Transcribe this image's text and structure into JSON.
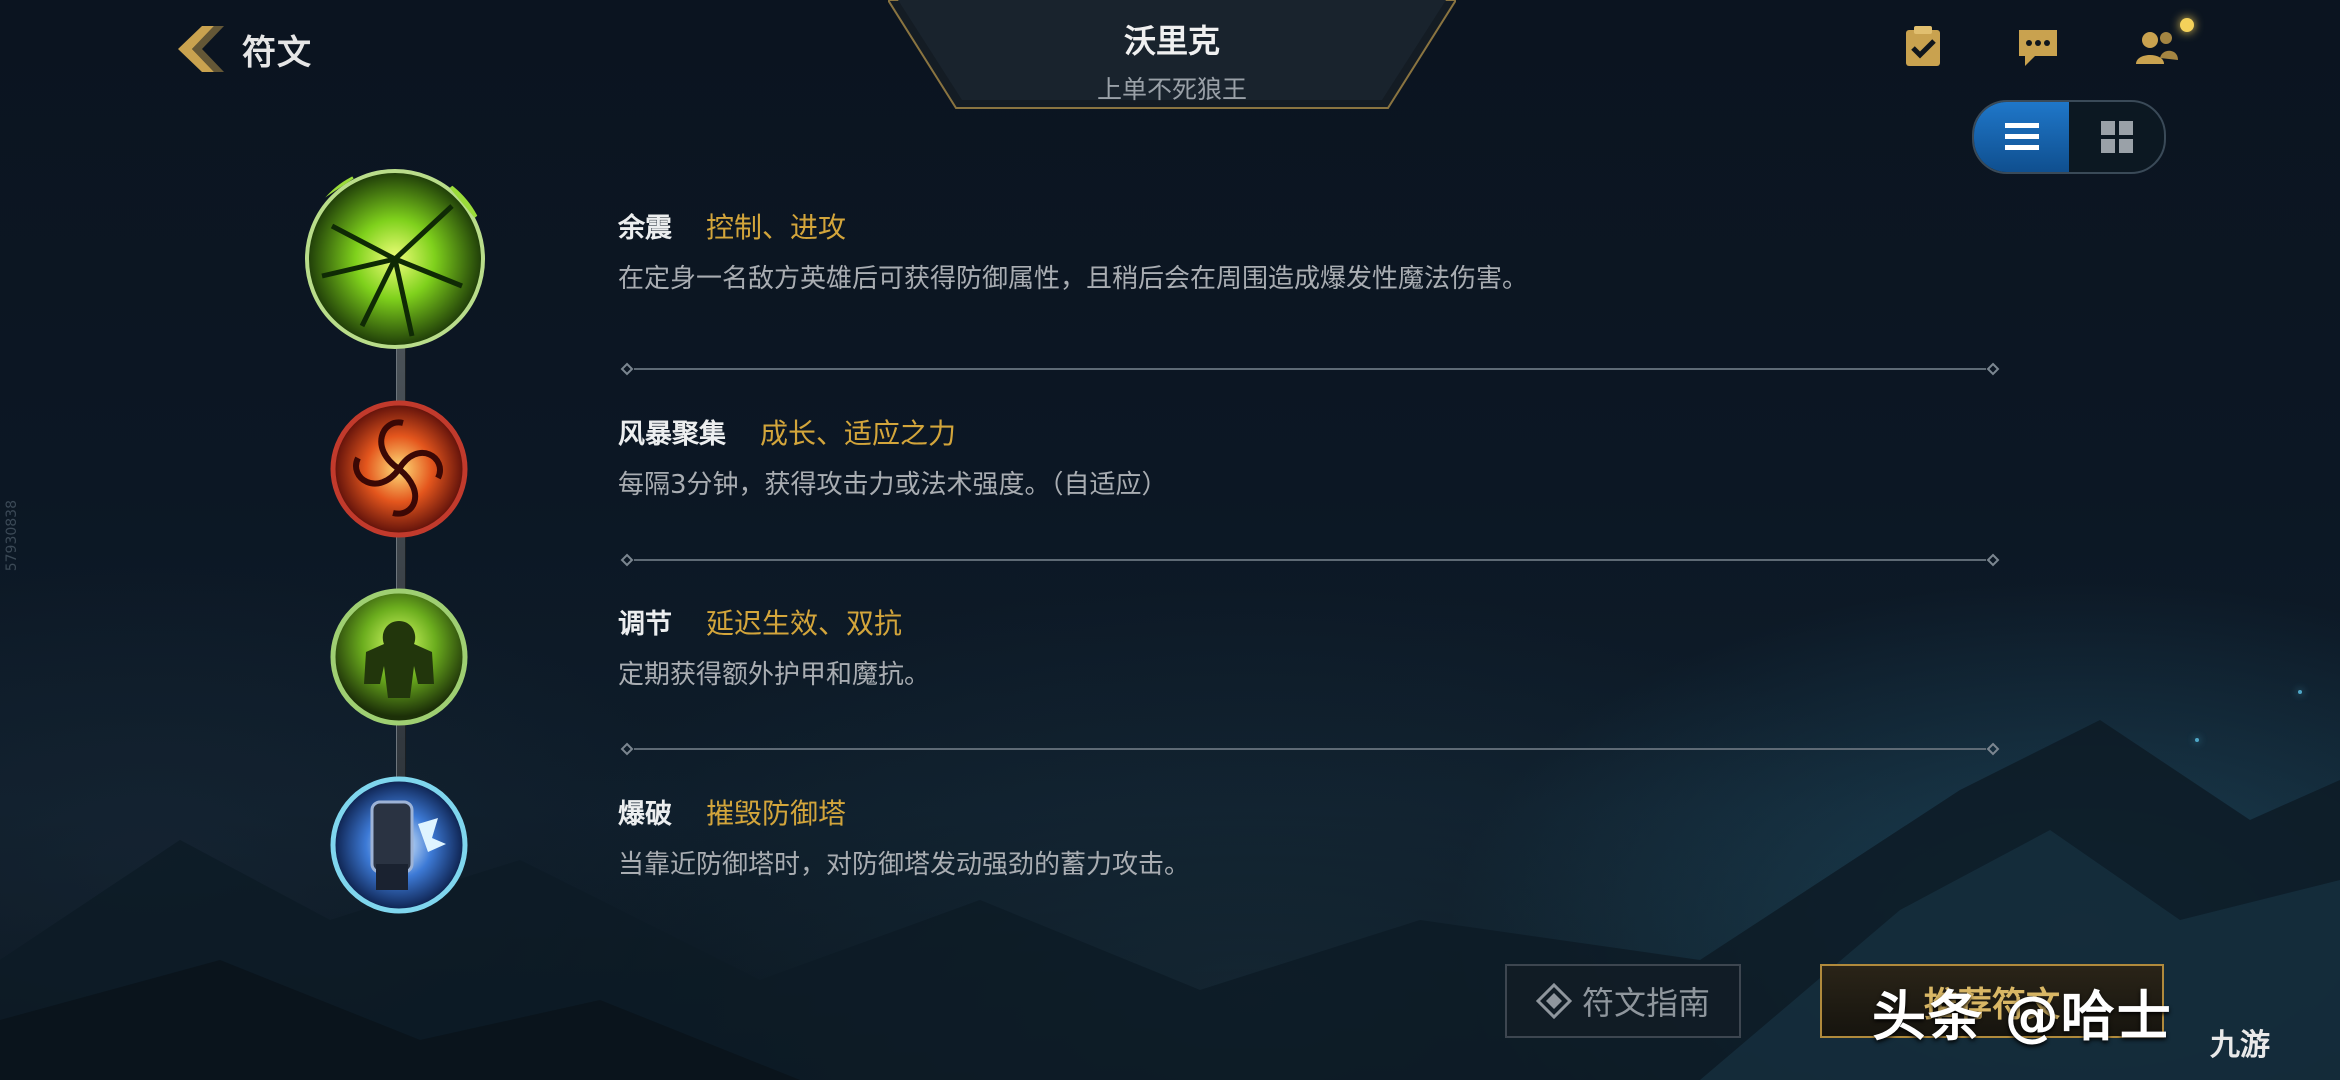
{
  "header": {
    "back_label": "符文",
    "hero_name": "沃里克",
    "hero_title": "上单不死狼王"
  },
  "top_icons": [
    "clipboard-check-icon",
    "chat-icon",
    "friends-icon"
  ],
  "view_toggle": {
    "selected": "list"
  },
  "runes": [
    {
      "name": "余震",
      "tags": "控制、进攻",
      "desc": "在定身一名敌方英雄后可获得防御属性，且稍后会在周围造成爆发性魔法伤害。",
      "color": "#7bd12a"
    },
    {
      "name": "风暴聚集",
      "tags": "成长、适应之力",
      "desc": "每隔3分钟，获得攻击力或法术强度。（自适应）",
      "color": "#d9422a"
    },
    {
      "name": "调节",
      "tags": "延迟生效、双抗",
      "desc": "定期获得额外护甲和魔抗。",
      "color": "#8fcf3a"
    },
    {
      "name": "爆破",
      "tags": "摧毁防御塔",
      "desc": "当靠近防御塔时，对防御塔发动强劲的蓄力攻击。",
      "color": "#3fb6e6"
    }
  ],
  "buttons": {
    "guide": "符文指南",
    "confirm": "推荐符文"
  },
  "watermark": {
    "text": "头条 @哈士",
    "logo": "九游"
  },
  "side_id": "57930838"
}
